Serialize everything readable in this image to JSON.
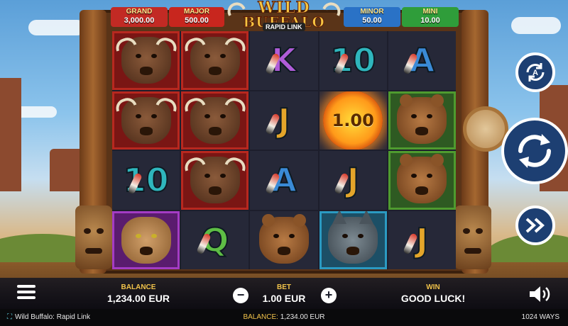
{
  "game": {
    "title": "Wild Buffalo: Rapid Link",
    "logo_line1": "WILD",
    "logo_line2": "BUFFALO",
    "logo_sub": "RAPID LINK"
  },
  "jackpots": {
    "grand": {
      "label": "GRAND",
      "value": "3,000.00"
    },
    "major": {
      "label": "MAJOR",
      "value": "500.00"
    },
    "minor": {
      "label": "MINOR",
      "value": "50.00"
    },
    "mini": {
      "label": "MINI",
      "value": "10.00"
    }
  },
  "reels": [
    [
      {
        "symbol": "buffalo",
        "bg": "red"
      },
      {
        "symbol": "buffalo",
        "bg": "red"
      },
      {
        "symbol": "K",
        "bg": "plain"
      },
      {
        "symbol": "10",
        "bg": "plain"
      },
      {
        "symbol": "A",
        "bg": "plain"
      }
    ],
    [
      {
        "symbol": "buffalo",
        "bg": "red"
      },
      {
        "symbol": "buffalo",
        "bg": "red"
      },
      {
        "symbol": "J",
        "bg": "plain"
      },
      {
        "symbol": "coin",
        "value": "1.00",
        "bg": "plain"
      },
      {
        "symbol": "bear",
        "bg": "green"
      }
    ],
    [
      {
        "symbol": "10",
        "bg": "plain"
      },
      {
        "symbol": "buffalo",
        "bg": "red"
      },
      {
        "symbol": "A",
        "bg": "plain"
      },
      {
        "symbol": "J",
        "bg": "plain"
      },
      {
        "symbol": "bear",
        "bg": "green"
      }
    ],
    [
      {
        "symbol": "cougar",
        "bg": "purple"
      },
      {
        "symbol": "Q",
        "bg": "plain"
      },
      {
        "symbol": "bear",
        "bg": "plain"
      },
      {
        "symbol": "wolf",
        "bg": "blue"
      },
      {
        "symbol": "J",
        "bg": "plain"
      }
    ]
  ],
  "controls": {
    "balance_label": "BALANCE",
    "balance_value": "1,234.00 EUR",
    "bet_label": "BET",
    "bet_value": "1.00 EUR",
    "minus": "−",
    "plus": "+",
    "win_label": "WIN",
    "win_value": "GOOD LUCK!"
  },
  "info_bar": {
    "title": "Wild Buffalo: Rapid Link",
    "balance_label": "BALANCE:",
    "balance_value": "1,234.00 EUR",
    "ways": "1024 WAYS"
  },
  "icons": {
    "menu": "hamburger-menu-icon",
    "autoplay": "autoplay-icon",
    "spin": "spin-icon",
    "turbo": "fast-forward-icon",
    "sound": "speaker-icon",
    "fullscreen": "fullscreen-icon"
  },
  "colors": {
    "accent_gold": "#f0c24a",
    "spin_button": "#1d3f72"
  }
}
